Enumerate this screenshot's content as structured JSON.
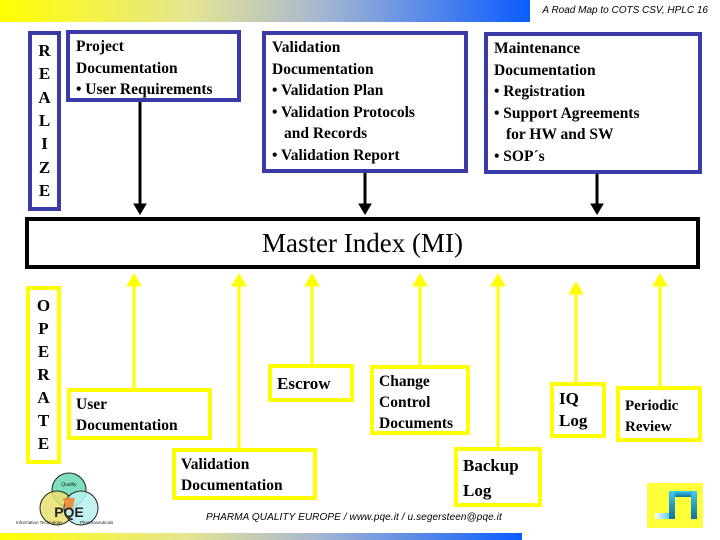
{
  "header": {
    "title": "A Road Map to COTS CSV, HPLC   16"
  },
  "footer": {
    "text": "PHARMA QUALITY EUROPE / www.pqe.it / u.segersteen@pqe.it"
  },
  "realize": {
    "letters": [
      "R",
      "E",
      "A",
      "L",
      "I",
      "Z",
      "E"
    ]
  },
  "operate": {
    "letters": [
      "O",
      "P",
      "E",
      "R",
      "A",
      "T",
      "E"
    ]
  },
  "top_boxes": {
    "project": {
      "lines": [
        "Project",
        "Documentation",
        "• User Requirements"
      ]
    },
    "validation": {
      "lines": [
        "Validation",
        "Documentation",
        "• Validation Plan",
        "• Validation Protocols",
        "and Records",
        "• Validation Report"
      ]
    },
    "maintenance": {
      "lines": [
        "Maintenance",
        "Documentation",
        "• Registration",
        "• Support Agreements",
        "for HW and SW",
        "• SOP´s"
      ]
    }
  },
  "master_index": {
    "label": "Master Index (MI)"
  },
  "bottom_boxes": {
    "user_doc": {
      "lines": [
        "User",
        "Documentation"
      ]
    },
    "validation_doc": {
      "lines": [
        "Validation",
        "Documentation"
      ]
    },
    "escrow": {
      "lines": [
        "Escrow"
      ]
    },
    "change_control": {
      "lines": [
        "Change",
        "Control",
        "Documents"
      ]
    },
    "backup_log": {
      "lines": [
        "Backup",
        "Log"
      ]
    },
    "iq_log": {
      "lines": [
        "IQ",
        "Log"
      ]
    },
    "periodic_review": {
      "lines": [
        "Periodic",
        "Review"
      ]
    }
  },
  "logo": {
    "name": "PQE",
    "labels": [
      "Quality",
      "Information Technology",
      "Pharmaceuticals"
    ]
  },
  "colors": {
    "realize_border": "#3a3aa8",
    "operate_border": "#ffff00",
    "master_border": "#000000"
  }
}
